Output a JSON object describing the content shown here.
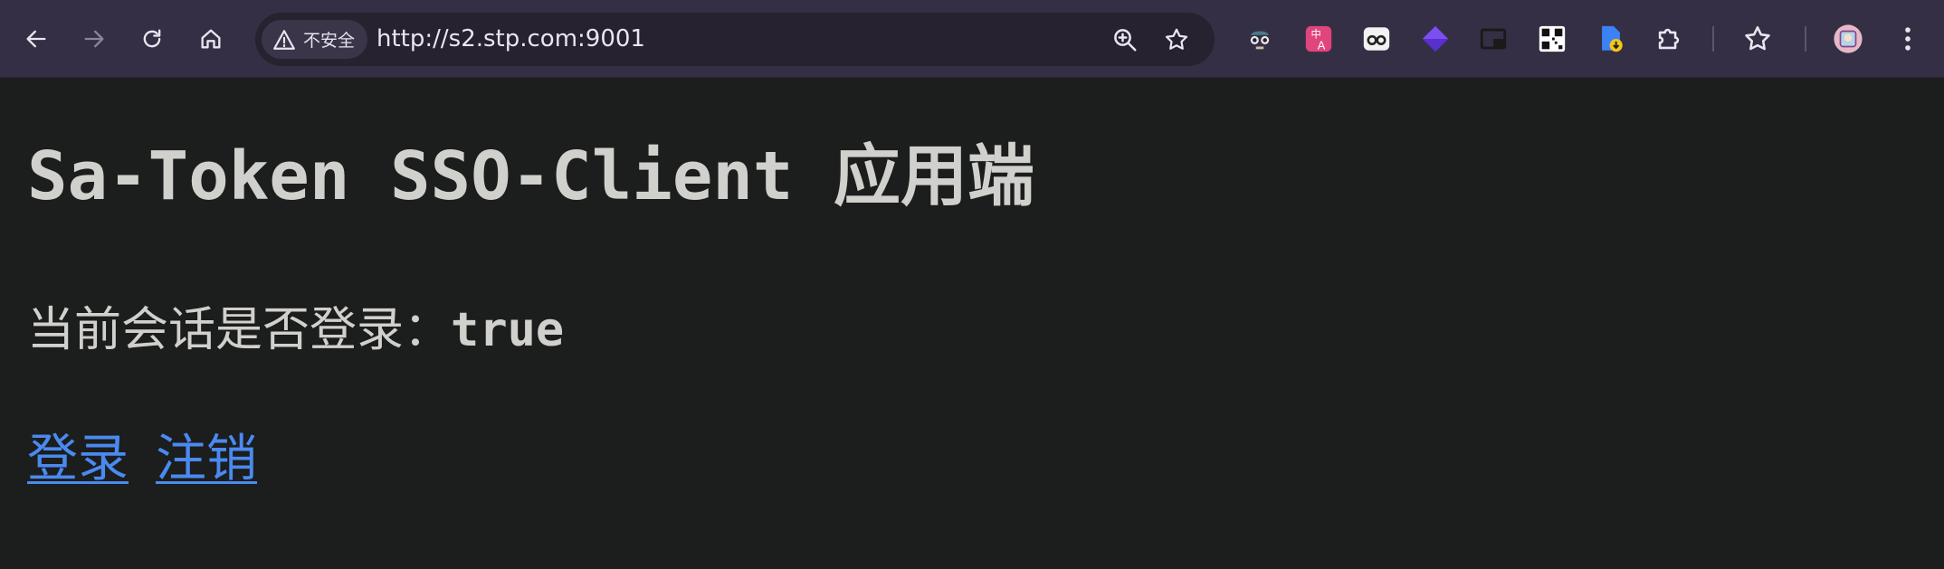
{
  "browser": {
    "security_label": "不安全",
    "url": "http://s2.stp.com:9001"
  },
  "icons": {
    "back": "back-arrow-icon",
    "forward": "forward-arrow-icon",
    "reload": "reload-icon",
    "home": "home-icon",
    "warning": "warning-triangle-icon",
    "zoom": "zoom-in-icon",
    "bookmark": "star-icon",
    "extensions": [
      "spy-glasses-icon",
      "translate-icon",
      "mask-icon",
      "purple-diamond-icon",
      "picture-in-picture-icon",
      "qr-code-icon",
      "file-download-icon",
      "puzzle-icon"
    ],
    "reading_list": "star-list-icon",
    "profile": "avatar",
    "menu": "kebab-menu-icon"
  },
  "colors": {
    "toolbar_bg": "#352f45",
    "page_bg": "#1c1d1d",
    "text": "#d0d0cc",
    "link": "#4a8af0"
  },
  "page": {
    "title": "Sa-Token SSO-Client 应用端",
    "status_label": "当前会话是否登录：",
    "status_value": "true",
    "login_link": "登录",
    "logout_link": "注销"
  }
}
